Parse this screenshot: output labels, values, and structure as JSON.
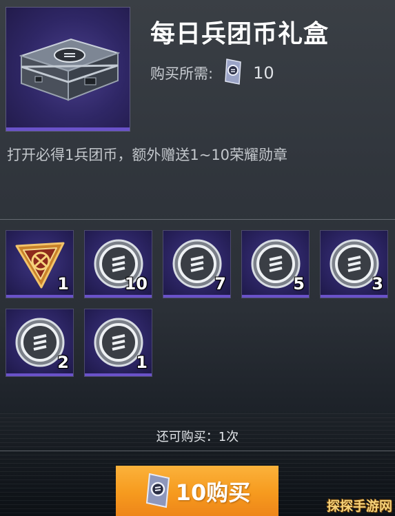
{
  "item": {
    "title": "每日兵团币礼盒",
    "price_label": "购买所需:",
    "price_currency_icon": "honor-medal-icon",
    "price_amount": "10",
    "description": "打开必得1兵团币，额外赠送1~10荣耀勋章"
  },
  "rewards": [
    {
      "icon": "legion-coin-icon",
      "quantity": "1"
    },
    {
      "icon": "honor-medal-icon",
      "quantity": "10"
    },
    {
      "icon": "honor-medal-icon",
      "quantity": "7"
    },
    {
      "icon": "honor-medal-icon",
      "quantity": "5"
    },
    {
      "icon": "honor-medal-icon",
      "quantity": "3"
    },
    {
      "icon": "honor-medal-icon",
      "quantity": "2"
    },
    {
      "icon": "honor-medal-icon",
      "quantity": "1"
    }
  ],
  "purchase": {
    "remaining_text": "还可购买：1次",
    "button_label": "10购买",
    "button_icon": "honor-medal-icon"
  },
  "watermark": "探探手游网",
  "colors": {
    "accent_purple": "#6a52c9",
    "button_orange": "#f69a1e",
    "background": "#30353c"
  }
}
